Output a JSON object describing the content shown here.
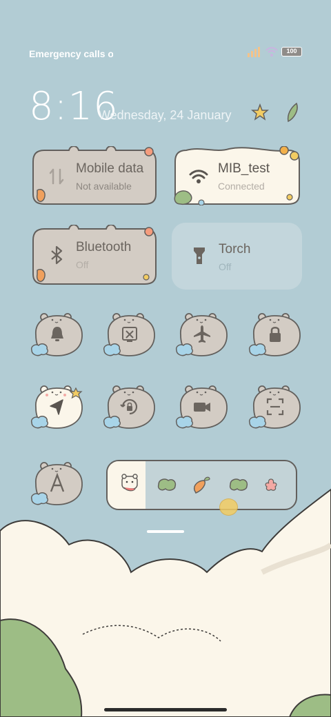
{
  "status_bar": {
    "carrier_text": "Emergency calls only",
    "battery_level": "100",
    "signal_icon": "signal-bars-icon",
    "wifi_icon": "wifi-icon"
  },
  "lockscreen": {
    "time": "8:16",
    "date": "Wednesday, 24 January"
  },
  "tiles": [
    {
      "title": "Mobile data",
      "subtitle": "Not available",
      "icon": "mobile-data-icon",
      "active": false
    },
    {
      "title": "MIB_test",
      "subtitle": "Connected",
      "icon": "wifi-icon",
      "active": true
    },
    {
      "title": "Bluetooth",
      "subtitle": "Off",
      "icon": "bluetooth-icon",
      "active": false
    },
    {
      "title": "Torch",
      "subtitle": "Off",
      "icon": "torch-icon",
      "active": false
    }
  ],
  "toggles": [
    {
      "name": "notification-bell",
      "icon": "bell-icon",
      "active": false
    },
    {
      "name": "screen-cast",
      "icon": "cast-icon",
      "active": false
    },
    {
      "name": "airplane-mode",
      "icon": "airplane-icon",
      "active": false
    },
    {
      "name": "screen-lock",
      "icon": "lock-icon",
      "active": false
    },
    {
      "name": "location",
      "icon": "location-arrow-icon",
      "active": true
    },
    {
      "name": "auto-rotate",
      "icon": "rotation-lock-icon",
      "active": false
    },
    {
      "name": "screen-recorder",
      "icon": "video-camera-icon",
      "active": false
    },
    {
      "name": "scanner",
      "icon": "scan-icon",
      "active": false
    },
    {
      "name": "font-size",
      "icon": "letter-a-icon",
      "active": false
    }
  ],
  "brightness": {
    "level": 0.2,
    "icons": [
      "bear-icon",
      "leaf-icon",
      "carrot-icon",
      "leaf-icon",
      "flower-icon"
    ]
  },
  "colors": {
    "background": "#b2ccd4",
    "tile_inactive": "#d3ccc4",
    "tile_active": "#fbf6ea",
    "outline": "#625f5c",
    "cloud": "#fbf6ea",
    "bush": "#9dbd85"
  }
}
